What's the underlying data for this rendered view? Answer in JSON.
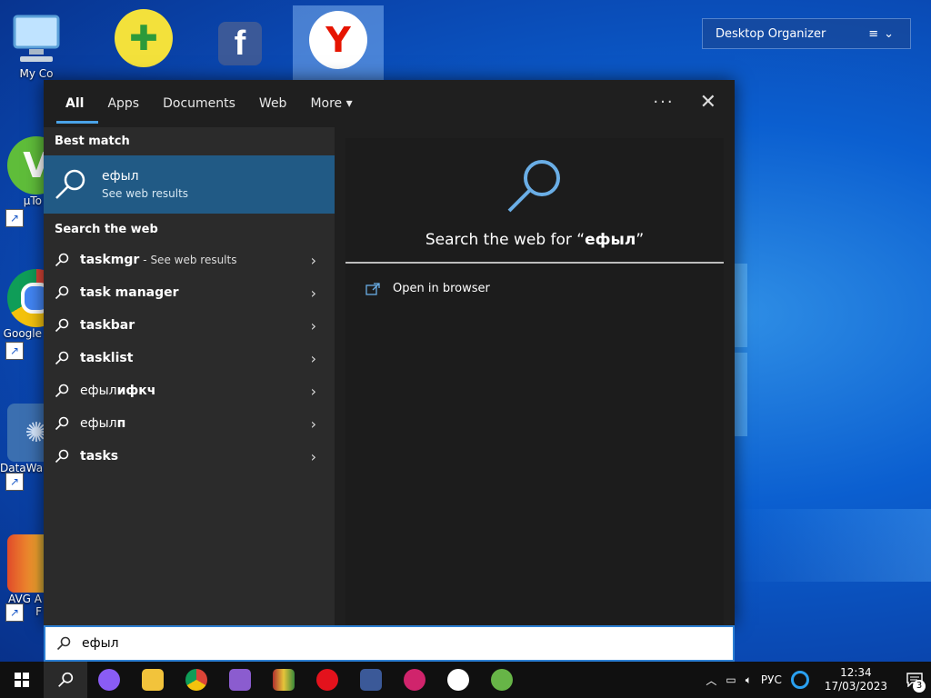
{
  "desktop": {
    "icons": [
      {
        "label": "My Co",
        "icon": "computer-icon"
      },
      {
        "label": "",
        "icon": "plus-app-icon"
      },
      {
        "label": "",
        "icon": "facebook-icon"
      },
      {
        "label": "",
        "icon": "yandex-icon"
      },
      {
        "label": "µTo",
        "icon": "vuze-icon"
      },
      {
        "label": "Google",
        "icon": "chrome-icon"
      },
      {
        "label": "DataWa",
        "icon": "datawatch-icon"
      },
      {
        "label": "AVG A\nF",
        "icon": "avg-icon"
      }
    ],
    "organizer": {
      "title": "Desktop Organizer"
    }
  },
  "search": {
    "tabs": [
      {
        "label": "All",
        "active": true
      },
      {
        "label": "Apps"
      },
      {
        "label": "Documents"
      },
      {
        "label": "Web"
      },
      {
        "label": "More"
      }
    ],
    "more_arrow": "▾",
    "overflow": "···",
    "close": "✕",
    "best_match_title": "Best match",
    "best_match": {
      "title": "ефыл",
      "subtitle": "See web results"
    },
    "search_web_title": "Search the web",
    "suggestions": [
      {
        "main": "taskmgr",
        "sub": " - See web results",
        "prefix": ""
      },
      {
        "main": "task manager",
        "sub": "",
        "prefix": ""
      },
      {
        "main": "taskbar",
        "sub": "",
        "prefix": ""
      },
      {
        "main": "tasklist",
        "sub": "",
        "prefix": ""
      },
      {
        "prefix": "ефыл",
        "main": "ифкч",
        "sub": ""
      },
      {
        "prefix": "ефыл",
        "main": "п",
        "sub": ""
      },
      {
        "main": "tasks",
        "sub": "",
        "prefix": ""
      }
    ],
    "preview": {
      "headline_prefix": "Search the web for “",
      "query": "ефыл",
      "headline_suffix": "”",
      "open_in_browser": "Open in browser"
    },
    "query": "ефыл"
  },
  "taskbar": {
    "apps": [
      {
        "name": "alice-icon",
        "color": "#8a5cf5",
        "glyph": "◯"
      },
      {
        "name": "file-explorer-icon",
        "color": "#f2c33b",
        "glyph": "▬"
      },
      {
        "name": "chrome-icon",
        "color": "#db4437",
        "glyph": "◉"
      },
      {
        "name": "visual-studio-icon",
        "color": "#8b5ccf",
        "glyph": "⋈"
      },
      {
        "name": "winrar-icon",
        "color": "#b0302d",
        "glyph": "▦"
      },
      {
        "name": "opera-icon",
        "color": "#e3121c",
        "glyph": "O"
      },
      {
        "name": "facebook-icon",
        "color": "#3b5998",
        "glyph": "f"
      },
      {
        "name": "opera-gx-icon",
        "color": "#d0246c",
        "glyph": "O"
      },
      {
        "name": "yandex-icon",
        "color": "#ffffff",
        "glyph": "Y"
      },
      {
        "name": "utorrent-icon",
        "color": "#67b547",
        "glyph": "µ"
      }
    ],
    "tray": {
      "lang": "РУС",
      "time": "12:34",
      "date": "17/03/2023",
      "notifications": "3"
    }
  }
}
